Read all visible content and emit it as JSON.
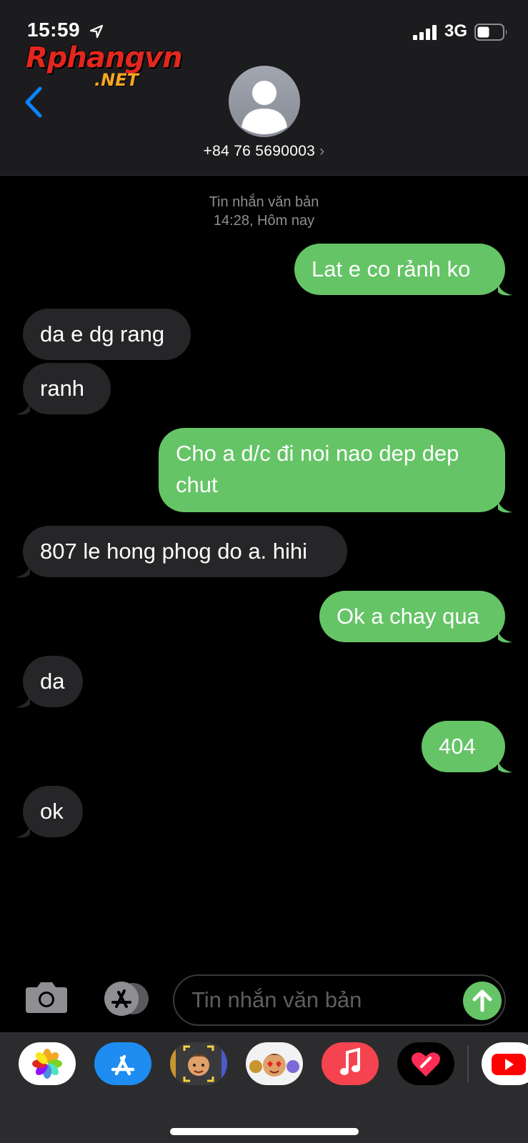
{
  "status_bar": {
    "time": "15:59",
    "network": "3G"
  },
  "watermark": {
    "main": "Rphangvn",
    "sub": ".NET"
  },
  "header": {
    "contact_number": "+84 76 5690003",
    "chevron": "›"
  },
  "conversation": {
    "meta_line1": "Tin nhắn văn bản",
    "meta_line2": "14:28, Hôm nay",
    "messages": [
      {
        "side": "out",
        "text": "Lat e co rảnh ko"
      },
      {
        "side": "in",
        "text": "da e dg rang"
      },
      {
        "side": "in",
        "text": "ranh"
      },
      {
        "side": "out",
        "text": "Cho a d/c đi noi nao dep dep chut"
      },
      {
        "side": "in",
        "text": "807 le hong phog do a. hihi"
      },
      {
        "side": "out",
        "text": "Ok a chay qua"
      },
      {
        "side": "in",
        "text": "da"
      },
      {
        "side": "out",
        "text": "404"
      },
      {
        "side": "in",
        "text": "ok"
      }
    ]
  },
  "input_bar": {
    "placeholder": "Tin nhắn văn bản"
  },
  "app_drawer": {
    "apps": [
      "photos-icon",
      "app-store-icon",
      "memoji-camera-icon",
      "memoji-stickers-icon",
      "music-icon",
      "digital-touch-icon",
      "youtube-icon"
    ]
  },
  "colors": {
    "outgoing_bubble": "#65c466",
    "incoming_bubble": "#262628",
    "accent_blue": "#0a84ff"
  }
}
